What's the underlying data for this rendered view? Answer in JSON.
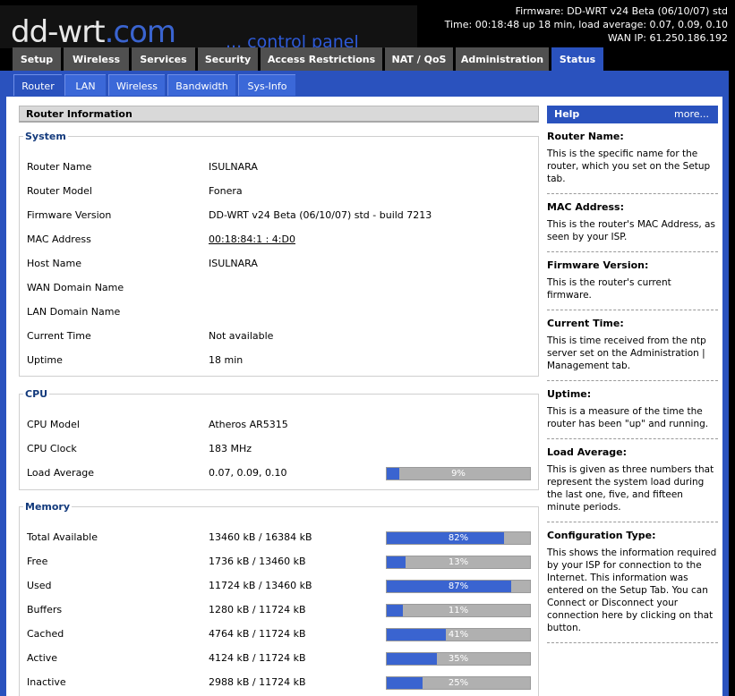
{
  "brand": {
    "logo_main": "dd-wrt",
    "logo_dotcom": ".com",
    "tagline": "... control panel"
  },
  "status_info": {
    "firmware": "Firmware: DD-WRT v24 Beta (06/10/07) std",
    "time": "Time: 00:18:48 up 18 min, load average: 0.07, 0.09, 0.10",
    "wan_ip": "WAN IP: 61.250.186.192"
  },
  "tabs": [
    {
      "label": "Setup"
    },
    {
      "label": "Wireless"
    },
    {
      "label": "Services"
    },
    {
      "label": "Security"
    },
    {
      "label": "Access Restrictions"
    },
    {
      "label": "NAT / QoS"
    },
    {
      "label": "Administration"
    },
    {
      "label": "Status",
      "active": true
    }
  ],
  "subtabs": [
    {
      "label": "Router",
      "active": true
    },
    {
      "label": "LAN"
    },
    {
      "label": "Wireless"
    },
    {
      "label": "Bandwidth"
    },
    {
      "label": "Sys-Info"
    }
  ],
  "page_title": "Router Information",
  "system": {
    "legend": "System",
    "rows": [
      {
        "label": "Router Name",
        "value": "ISULNARA"
      },
      {
        "label": "Router Model",
        "value": "Fonera"
      },
      {
        "label": "Firmware Version",
        "value": "DD-WRT v24 Beta (06/10/07) std - build 7213"
      },
      {
        "label": "MAC Address",
        "value": "00:18:84:1 : 4:D0"
      },
      {
        "label": "Host Name",
        "value": "ISULNARA"
      },
      {
        "label": "WAN Domain Name",
        "value": ""
      },
      {
        "label": "LAN Domain Name",
        "value": ""
      },
      {
        "label": "Current Time",
        "value": "Not available"
      },
      {
        "label": "Uptime",
        "value": "18 min"
      }
    ]
  },
  "cpu": {
    "legend": "CPU",
    "rows": [
      {
        "label": "CPU Model",
        "value": "Atheros AR5315"
      },
      {
        "label": "CPU Clock",
        "value": "183 MHz"
      },
      {
        "label": "Load Average",
        "value": "0.07, 0.09, 0.10",
        "percent": 9,
        "percent_label": "9%"
      }
    ]
  },
  "memory": {
    "legend": "Memory",
    "rows": [
      {
        "label": "Total Available",
        "value": "13460 kB / 16384 kB",
        "percent": 82,
        "percent_label": "82%"
      },
      {
        "label": "Free",
        "value": "1736 kB / 13460 kB",
        "percent": 13,
        "percent_label": "13%"
      },
      {
        "label": "Used",
        "value": "11724 kB / 13460 kB",
        "percent": 87,
        "percent_label": "87%"
      },
      {
        "label": "Buffers",
        "value": "1280 kB / 11724 kB",
        "percent": 11,
        "percent_label": "11%"
      },
      {
        "label": "Cached",
        "value": "4764 kB / 11724 kB",
        "percent": 41,
        "percent_label": "41%"
      },
      {
        "label": "Active",
        "value": "4124 kB / 11724 kB",
        "percent": 35,
        "percent_label": "35%"
      },
      {
        "label": "Inactive",
        "value": "2988 kB / 11724 kB",
        "percent": 25,
        "percent_label": "25%"
      }
    ]
  },
  "help": {
    "title": "Help",
    "more": "more...",
    "sections": [
      {
        "title": "Router Name:",
        "text": "This is the specific name for the router, which you set on the Setup tab."
      },
      {
        "title": "MAC Address:",
        "text": "This is the router's MAC Address, as seen by your ISP."
      },
      {
        "title": "Firmware Version:",
        "text": "This is the router's current firmware."
      },
      {
        "title": "Current Time:",
        "text": "This is time received from the ntp server set on the Administration | Management tab."
      },
      {
        "title": "Uptime:",
        "text": "This is a measure of the time the router has been \"up\" and running."
      },
      {
        "title": "Load Average:",
        "text": "This is given as three numbers that represent the system load during the last one, five, and fifteen minute periods."
      },
      {
        "title": "Configuration Type:",
        "text": "This shows the information required by your ISP for connection to the Internet. This information was entered on the Setup Tab. You can Connect or Disconnect your connection here by clicking on that button."
      }
    ]
  },
  "colors": {
    "accent": "#2a52be",
    "bar_fill": "#3a64d0",
    "bar_bg": "#b0b0b0",
    "legend": "#133a7c"
  }
}
